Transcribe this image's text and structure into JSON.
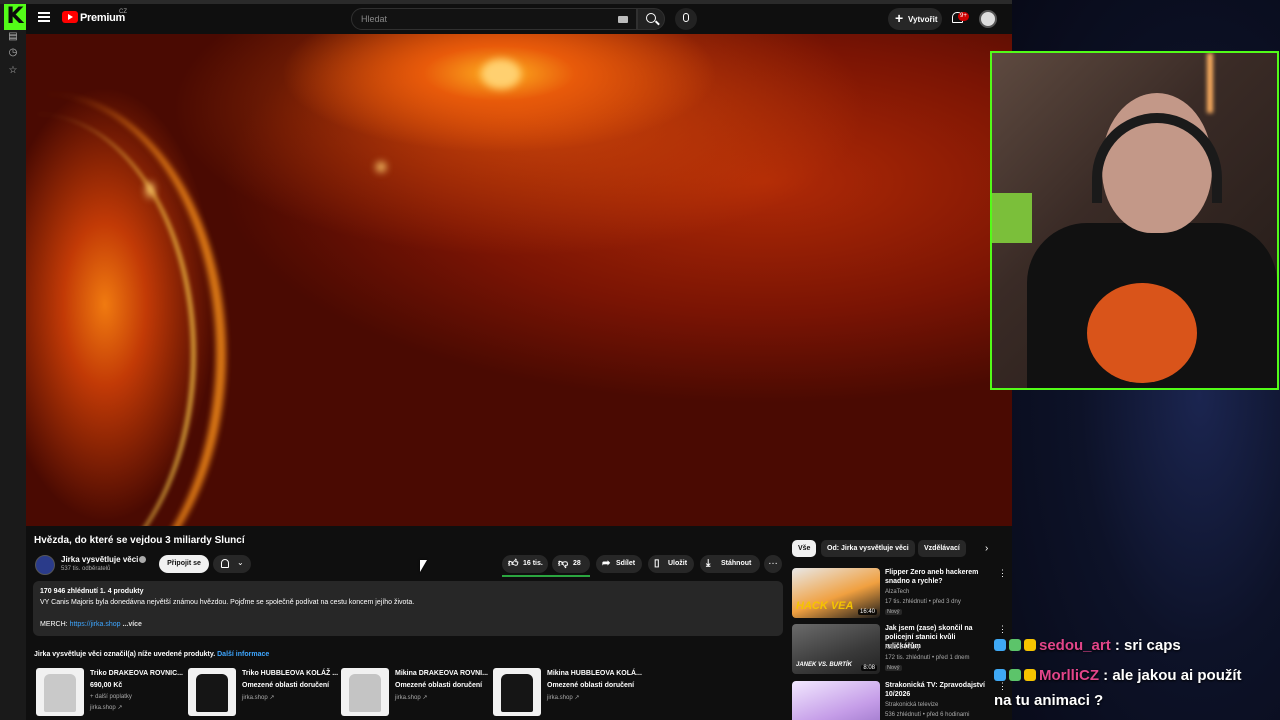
{
  "header": {
    "brand": "Premium",
    "region": "CZ",
    "search_placeholder": "Hledat",
    "create_label": "Vytvořit",
    "notif_count": "9+"
  },
  "video": {
    "title": "Hvězda, do které se vejdou 3 miliardy Sluncí",
    "channel": "Jirka vysvětluje věci",
    "subscribers": "537 tis. odběratelů",
    "join_label": "Připojit se",
    "likes": "16 tis.",
    "dislikes": "28",
    "share_label": "Sdílet",
    "save_label": "Uložit",
    "download_label": "Stáhnout"
  },
  "description": {
    "stats": "170 946 zhlédnutí  1.   4 produkty",
    "text": "VY Canis Majoris byla donedávna největší známou hvězdou. Pojďme se společně podívat na cestu koncem jejího života.",
    "merch_label": "MERCH: ",
    "merch_link": "https://jirka.shop",
    "more_label": "...více"
  },
  "products": {
    "heading": "Jirka vysvětluje věci označil(a) níže uvedené produkty.",
    "more_link": "Další informace",
    "items": [
      {
        "name": "Triko DRAKEOVA ROVNIC...",
        "price": "690,00 Kč",
        "extra": "+ další poplatky",
        "shop": "jirka.shop ↗",
        "color": "#c9c9c9"
      },
      {
        "name": "Triko HUBBLEOVA KOLÁŽ ...",
        "price": "Omezené oblasti doručení",
        "extra": "",
        "shop": "jirka.shop ↗",
        "color": "#151515"
      },
      {
        "name": "Mikina DRAKEOVA ROVNI...",
        "price": "Omezené oblasti doručení",
        "extra": "",
        "shop": "jirka.shop ↗",
        "color": "#c4c4c4"
      },
      {
        "name": "Mikina HUBBLEOVA KOLÁ...",
        "price": "Omezené oblasti doručení",
        "extra": "",
        "shop": "jirka.shop ↗",
        "color": "#151515"
      }
    ]
  },
  "chips": [
    "Vše",
    "Od: Jirka vysvětluje věci",
    "Vzdělávací"
  ],
  "recommendations": [
    {
      "title": "Flipper Zero aneb hackerem snadno a rychle?",
      "channel": "AlzaTech",
      "meta": "17 tis. zhlédnutí • před 3 dny",
      "badge": "Nový",
      "duration": "16:40",
      "thumb_text": "HACK VEA"
    },
    {
      "title": "Jak jsem (zase) skončil na policejní stanici kvůli ruličkářům",
      "channel": "Kluci z Prahy",
      "meta": "172 tis. zhlédnutí • před 1 dnem",
      "badge": "Nový",
      "duration": "8:08",
      "thumb_text": "JANEK VS. BURTÍK"
    },
    {
      "title": "Strakonická TV: Zpravodajství 10/2026",
      "channel": "Strakonická televize",
      "meta": "536 zhlédnutí • před 6 hodinami",
      "badge": "",
      "duration": "",
      "thumb_text": ""
    }
  ],
  "chat": [
    {
      "user": "sedou_art",
      "message": " : sri caps",
      "color": "#e2458a"
    },
    {
      "user": "MorlliCZ",
      "message": " : ale jakou ai použít",
      "message2": "na tu animaci ?",
      "color": "#e2458a"
    }
  ]
}
